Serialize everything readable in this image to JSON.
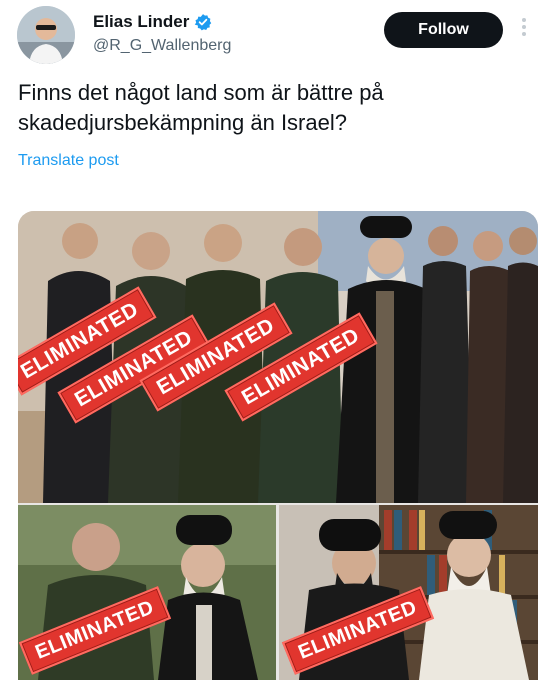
{
  "author": {
    "display_name": "Elias Linder",
    "handle": "@R_G_Wallenberg",
    "verified": true
  },
  "actions": {
    "follow_label": "Follow"
  },
  "post": {
    "text": "Finns det något land som är bättre på skadedjursbekämpning än Israel?",
    "translate_label": "Translate post"
  },
  "media": {
    "stamp_text": "ELIMINATED",
    "stamp_color": "#e1352e",
    "panels": [
      "top-group-photo",
      "bottom-left-photo",
      "bottom-right-photo"
    ]
  },
  "colors": {
    "link": "#1d9bf0",
    "text": "#0f1419",
    "secondary": "#536471",
    "button_bg": "#0f1419"
  }
}
